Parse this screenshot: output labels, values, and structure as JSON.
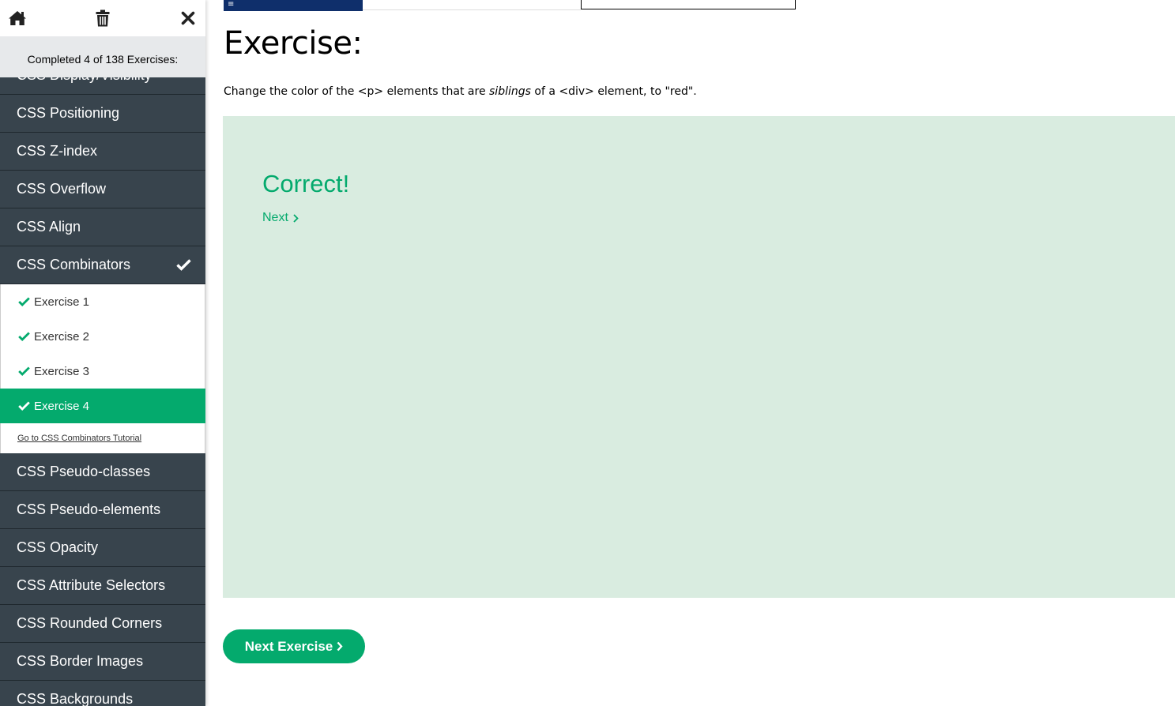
{
  "sidebar": {
    "progress_text": "Completed 4 of 138 Exercises:",
    "partial_category": "CSS Display/Visibility",
    "categories_before": [
      {
        "label": "CSS Positioning"
      },
      {
        "label": "CSS Z-index"
      },
      {
        "label": "CSS Overflow"
      },
      {
        "label": "CSS Align"
      }
    ],
    "active_category": {
      "label": "CSS Combinators",
      "completed": true
    },
    "exercises": [
      {
        "label": "Exercise 1",
        "completed": true
      },
      {
        "label": "Exercise 2",
        "completed": true
      },
      {
        "label": "Exercise 3",
        "completed": true
      },
      {
        "label": "Exercise 4",
        "completed": true,
        "current": true
      }
    ],
    "tutorial_link": "Go to CSS Combinators Tutorial",
    "categories_after": [
      {
        "label": "CSS Pseudo-classes"
      },
      {
        "label": "CSS Pseudo-elements"
      },
      {
        "label": "CSS Opacity"
      },
      {
        "label": "CSS Attribute Selectors"
      },
      {
        "label": "CSS Rounded Corners"
      },
      {
        "label": "CSS Border Images"
      },
      {
        "label": "CSS Backgrounds"
      }
    ],
    "icons": [
      "home-icon",
      "trash-icon",
      "close-icon"
    ]
  },
  "main": {
    "topbar_glyph": "≡",
    "title": "Exercise:",
    "description": {
      "part1": "Change the color of the <p> elements that are ",
      "emphasis": "siblings",
      "part2": " of a <div> element, to \"red\"."
    },
    "result": {
      "heading": "Correct!",
      "next_link": "Next"
    },
    "next_exercise_button": "Next Exercise"
  },
  "colors": {
    "accent": "#04aa6d",
    "sidebar_bg": "#38444d",
    "result_bg": "#d9ece0",
    "topbar_blue": "#0f2f6b"
  }
}
